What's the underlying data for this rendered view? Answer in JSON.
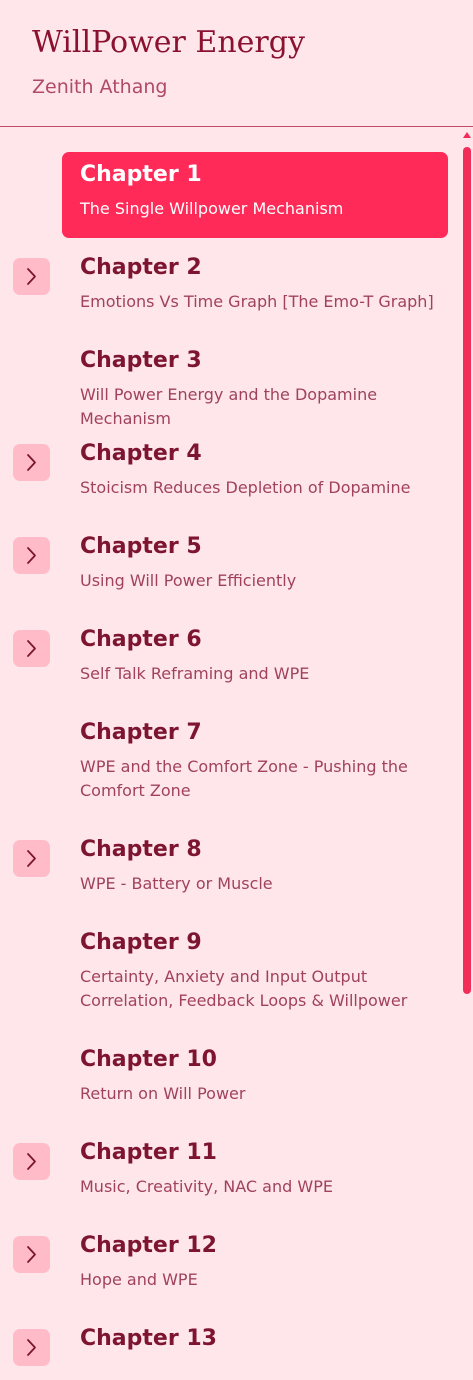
{
  "header": {
    "title": "WillPower Energy",
    "author": "Zenith Athang"
  },
  "chapters": [
    {
      "title": "Chapter 1",
      "subtitle": "The Single Willpower Mechanism",
      "active": true,
      "expandable": false
    },
    {
      "title": "Chapter 2",
      "subtitle": "Emotions Vs Time Graph [The Emo-T Graph]",
      "active": false,
      "expandable": true
    },
    {
      "title": "Chapter 3",
      "subtitle": "Will Power Energy and the Dopamine Mechanism",
      "active": false,
      "expandable": false
    },
    {
      "title": "Chapter 4",
      "subtitle": "Stoicism Reduces Depletion of Dopamine",
      "active": false,
      "expandable": true
    },
    {
      "title": "Chapter 5",
      "subtitle": "Using Will Power Efficiently",
      "active": false,
      "expandable": true
    },
    {
      "title": "Chapter 6",
      "subtitle": "Self Talk Reframing and WPE",
      "active": false,
      "expandable": true
    },
    {
      "title": "Chapter 7",
      "subtitle": "WPE and the Comfort Zone - Pushing the Comfort Zone",
      "active": false,
      "expandable": false
    },
    {
      "title": "Chapter 8",
      "subtitle": "WPE - Battery or Muscle",
      "active": false,
      "expandable": true
    },
    {
      "title": "Chapter 9",
      "subtitle": "Certainty, Anxiety and Input Output Correlation, Feedback Loops & Willpower",
      "active": false,
      "expandable": false
    },
    {
      "title": "Chapter 10",
      "subtitle": "Return on Will Power",
      "active": false,
      "expandable": false
    },
    {
      "title": "Chapter 11",
      "subtitle": "Music, Creativity, NAC and WPE",
      "active": false,
      "expandable": true
    },
    {
      "title": "Chapter 12",
      "subtitle": "Hope and WPE",
      "active": false,
      "expandable": true
    },
    {
      "title": "Chapter 13",
      "subtitle": "",
      "active": false,
      "expandable": true
    }
  ],
  "colors": {
    "background": "#ffe6ea",
    "accent": "#ff2a58",
    "title": "#8a1230",
    "chapter_title": "#7d1430",
    "chapter_subtitle": "#a0425c",
    "expander_bg": "#ffbcc8"
  },
  "icons": {
    "expander": "chevron-right-icon",
    "scroll_up": "triangle-up-icon"
  }
}
